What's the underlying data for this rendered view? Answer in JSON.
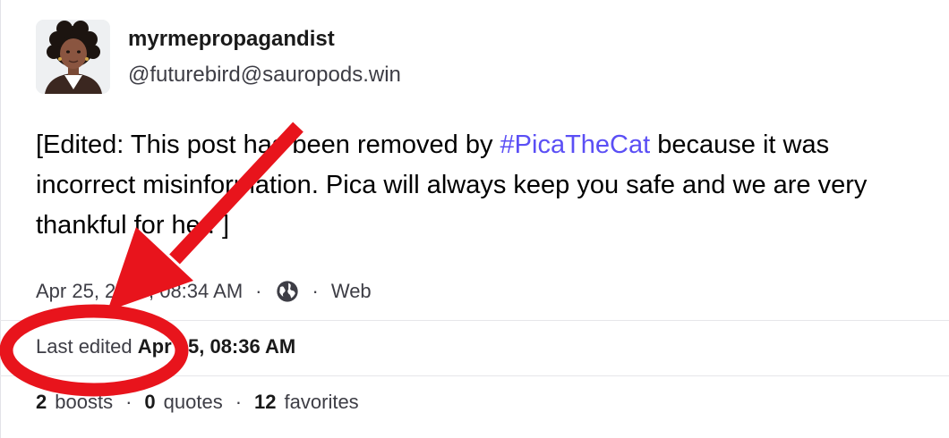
{
  "author": {
    "display_name": "myrmepropagandist",
    "handle": "@futurebird@sauropods.win"
  },
  "post": {
    "text_before": "[Edited: This post has been removed by ",
    "hashtag": "#PicaTheCat",
    "text_after": " because it was incorrect misinformation. Pica will always keep you safe and we are very thankful for her. ]"
  },
  "meta": {
    "timestamp": "Apr 25, 2025, 08:34 AM",
    "separator": "·",
    "visibility_icon": "globe-icon",
    "application": "Web"
  },
  "edited": {
    "label": "Last edited",
    "time": "Apr 25, 08:36 AM"
  },
  "stats": {
    "boosts_count": "2",
    "boosts_label": "boosts",
    "quotes_count": "0",
    "quotes_label": "quotes",
    "favorites_count": "12",
    "favorites_label": "favorites"
  },
  "colors": {
    "hashtag": "#5b4ff5",
    "annotation": "#e8141c"
  }
}
